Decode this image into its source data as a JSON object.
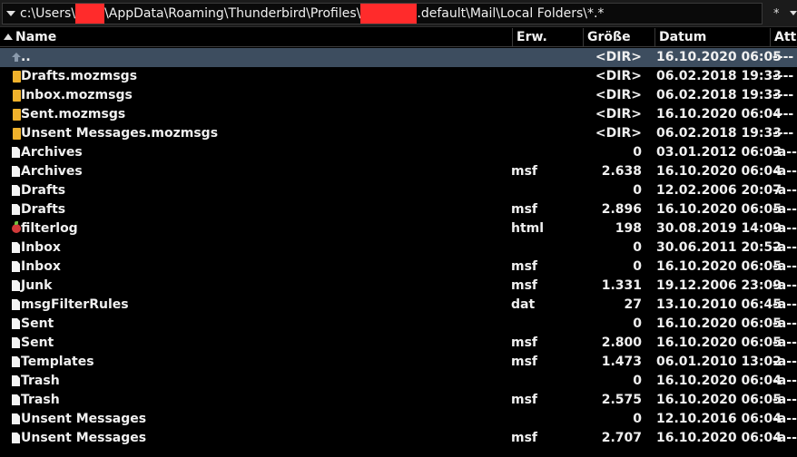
{
  "path": {
    "segments": [
      "c:\\Users\\",
      "",
      "\\AppData\\Roaming\\Thunderbird\\Profiles\\",
      "",
      ".default\\Mail\\Local Folders\\*.*"
    ],
    "star": "*"
  },
  "columns": {
    "name": "Name",
    "ext": "Erw.",
    "size": "Größe",
    "date": "Datum",
    "attr": "Att"
  },
  "files": [
    {
      "icon": "up-folder-icon",
      "name": "..",
      "ext": "",
      "size": "<DIR>",
      "date": "16.10.2020 06:05",
      "attr": "----",
      "selected": true
    },
    {
      "icon": "folder-icon",
      "name": "Drafts.mozmsgs",
      "ext": "",
      "size": "<DIR>",
      "date": "06.02.2018 19:33",
      "attr": "----"
    },
    {
      "icon": "folder-icon",
      "name": "Inbox.mozmsgs",
      "ext": "",
      "size": "<DIR>",
      "date": "06.02.2018 19:33",
      "attr": "----"
    },
    {
      "icon": "folder-icon",
      "name": "Sent.mozmsgs",
      "ext": "",
      "size": "<DIR>",
      "date": "16.10.2020 06:04",
      "attr": "----"
    },
    {
      "icon": "folder-icon",
      "name": "Unsent Messages.mozmsgs",
      "ext": "",
      "size": "<DIR>",
      "date": "06.02.2018 19:33",
      "attr": "----"
    },
    {
      "icon": "file-icon",
      "name": "Archives",
      "ext": "",
      "size": "0",
      "date": "03.01.2012 06:03",
      "attr": "-a--"
    },
    {
      "icon": "file-icon",
      "name": "Archives",
      "ext": "msf",
      "size": "2.638",
      "date": "16.10.2020 06:04",
      "attr": "-a--"
    },
    {
      "icon": "file-icon",
      "name": "Drafts",
      "ext": "",
      "size": "0",
      "date": "12.02.2006 20:07",
      "attr": "-a--"
    },
    {
      "icon": "file-icon",
      "name": "Drafts",
      "ext": "msf",
      "size": "2.896",
      "date": "16.10.2020 06:05",
      "attr": "-a--"
    },
    {
      "icon": "html-file-icon",
      "name": "filterlog",
      "ext": "html",
      "size": "198",
      "date": "30.08.2019 14:09",
      "attr": "-a--"
    },
    {
      "icon": "file-icon",
      "name": "Inbox",
      "ext": "",
      "size": "0",
      "date": "30.06.2011 20:52",
      "attr": "-a--"
    },
    {
      "icon": "file-icon",
      "name": "Inbox",
      "ext": "msf",
      "size": "0",
      "date": "16.10.2020 06:05",
      "attr": "-a--"
    },
    {
      "icon": "file-icon",
      "name": "Junk",
      "ext": "msf",
      "size": "1.331",
      "date": "19.12.2006 23:09",
      "attr": "-a--"
    },
    {
      "icon": "file-icon",
      "name": "msgFilterRules",
      "ext": "dat",
      "size": "27",
      "date": "13.10.2010 06:45",
      "attr": "-a--"
    },
    {
      "icon": "file-icon",
      "name": "Sent",
      "ext": "",
      "size": "0",
      "date": "16.10.2020 06:05",
      "attr": "-a--"
    },
    {
      "icon": "file-icon",
      "name": "Sent",
      "ext": "msf",
      "size": "2.800",
      "date": "16.10.2020 06:05",
      "attr": "-a--"
    },
    {
      "icon": "file-icon",
      "name": "Templates",
      "ext": "msf",
      "size": "1.473",
      "date": "06.01.2010 13:02",
      "attr": "-a--"
    },
    {
      "icon": "file-icon",
      "name": "Trash",
      "ext": "",
      "size": "0",
      "date": "16.10.2020 06:04",
      "attr": "-a--"
    },
    {
      "icon": "file-icon",
      "name": "Trash",
      "ext": "msf",
      "size": "2.575",
      "date": "16.10.2020 06:05",
      "attr": "-a--"
    },
    {
      "icon": "file-icon",
      "name": "Unsent Messages",
      "ext": "",
      "size": "0",
      "date": "12.10.2016 06:04",
      "attr": "-a--"
    },
    {
      "icon": "file-icon",
      "name": "Unsent Messages",
      "ext": "msf",
      "size": "2.707",
      "date": "16.10.2020 06:04",
      "attr": "-a--"
    }
  ]
}
